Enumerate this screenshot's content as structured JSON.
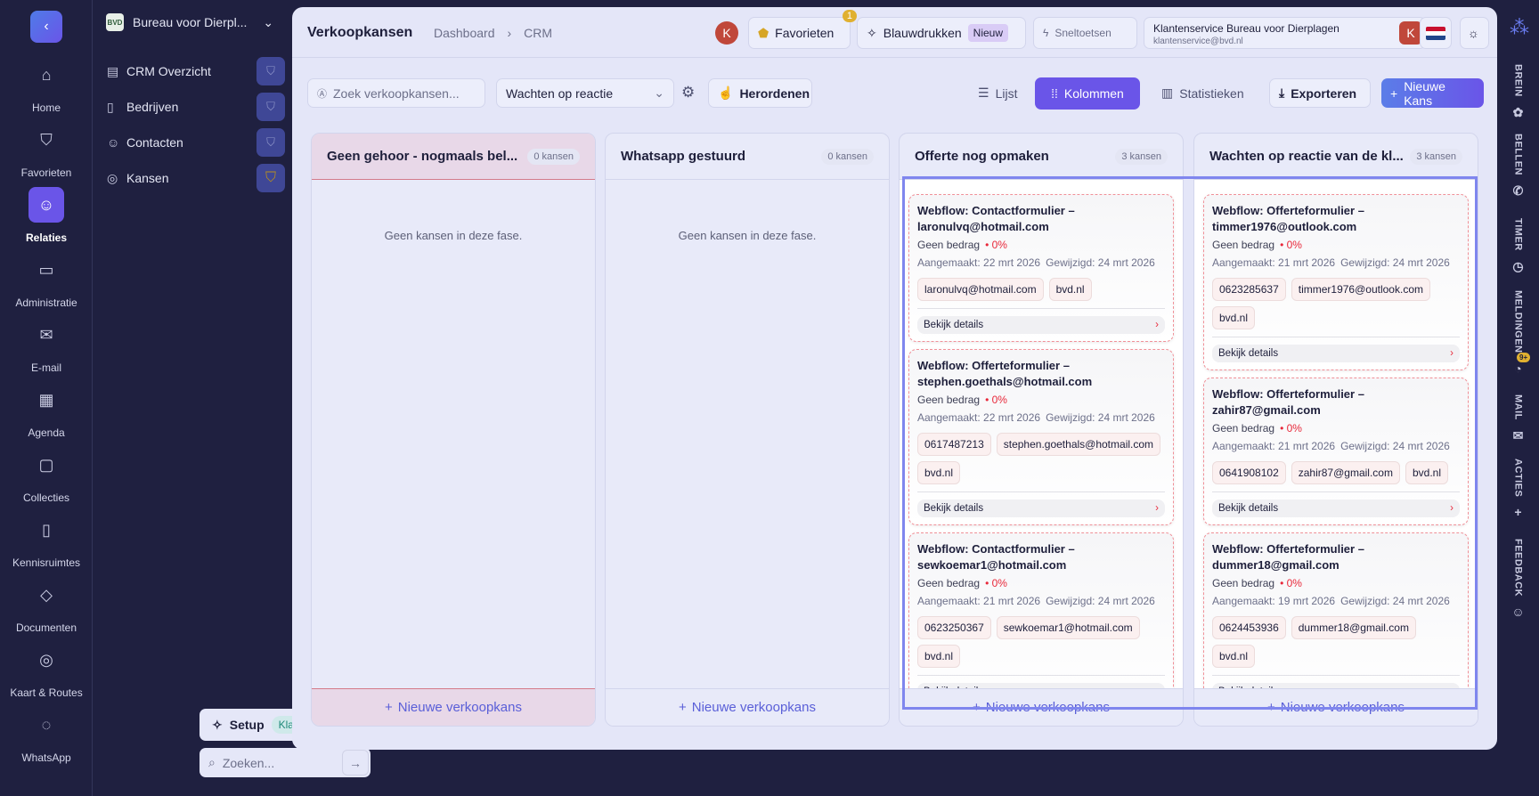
{
  "rail": {
    "items": [
      {
        "label": "Home",
        "icon": "home-icon"
      },
      {
        "label": "Favorieten",
        "icon": "shield-icon"
      },
      {
        "label": "Relaties",
        "icon": "contact-icon",
        "active": true
      },
      {
        "label": "Administratie",
        "icon": "wallet-icon"
      },
      {
        "label": "E-mail",
        "icon": "mail-icon"
      },
      {
        "label": "Agenda",
        "icon": "calendar-icon"
      },
      {
        "label": "Collecties",
        "icon": "box-icon"
      },
      {
        "label": "Kennisruimtes",
        "icon": "book-icon"
      },
      {
        "label": "Documenten",
        "icon": "document-icon"
      },
      {
        "label": "Kaart & Routes",
        "icon": "map-pin-icon"
      },
      {
        "label": "WhatsApp",
        "icon": "chat-icon"
      }
    ]
  },
  "sidebar": {
    "org": "Bureau voor Dierpl...",
    "logo": "BVD",
    "items": [
      {
        "label": "CRM Overzicht"
      },
      {
        "label": "Bedrijven"
      },
      {
        "label": "Contacten"
      },
      {
        "label": "Kansen",
        "favorite": true
      }
    ],
    "setup": "Setup",
    "setup_status": "Klaar",
    "search_placeholder": "Zoeken..."
  },
  "header": {
    "title": "Verkoopkansen",
    "breadcrumb": [
      "Dashboard",
      "CRM"
    ],
    "avatar": "K",
    "favorieten": "Favorieten",
    "fav_count": "1",
    "blauwdrukken": "Blauwdrukken",
    "nieuw": "Nieuw",
    "sneltoetsen": "Sneltoetsen",
    "account_name": "Klantenservice Bureau voor Dierplagen",
    "account_email": "klantenservice@bvd.nl",
    "account_avatar": "K"
  },
  "toolbar": {
    "search_placeholder": "Zoek verkoopkansen...",
    "filter": "Wachten op reactie",
    "reorder": "Herordenen",
    "views": [
      "Lijst",
      "Kolommen",
      "Statistieken"
    ],
    "active_view": "Kolommen",
    "export": "Exporteren",
    "new": "Nieuwe Kans"
  },
  "colors": {
    "accent": "#6a55e8",
    "danger": "#e8283a"
  },
  "columns": [
    {
      "name": "Geen gehoor - nogmaals bel...",
      "count": "0 kansen",
      "empty": "Geen kansen in deze fase.",
      "add": "Nieuwe verkoopkans",
      "cards": []
    },
    {
      "name": "Whatsapp gestuurd",
      "count": "0 kansen",
      "empty": "Geen kansen in deze fase.",
      "add": "Nieuwe verkoopkans",
      "cards": []
    },
    {
      "name": "Offerte nog opmaken",
      "count": "3 kansen",
      "add": "Nieuwe verkoopkans",
      "cards": [
        {
          "title": "Webflow: Contactformulier – laronulvq@hotmail.com",
          "amount": "Geen bedrag",
          "pct": "• 0%",
          "created": "Aangemaakt: 22 mrt 2026",
          "modified": "Gewijzigd: 24 mrt 2026",
          "tags": [
            "laronulvq@hotmail.com",
            "bvd.nl"
          ],
          "details": "Bekijk details"
        },
        {
          "title": "Webflow: Offerteformulier – stephen.goethals@hotmail.com",
          "amount": "Geen bedrag",
          "pct": "• 0%",
          "created": "Aangemaakt: 22 mrt 2026",
          "modified": "Gewijzigd: 24 mrt 2026",
          "tags": [
            "0617487213",
            "stephen.goethals@hotmail.com",
            "bvd.nl"
          ],
          "details": "Bekijk details"
        },
        {
          "title": "Webflow: Contactformulier – sewkoemar1@hotmail.com",
          "amount": "Geen bedrag",
          "pct": "• 0%",
          "created": "Aangemaakt: 21 mrt 2026",
          "modified": "Gewijzigd: 24 mrt 2026",
          "tags": [
            "0623250367",
            "sewkoemar1@hotmail.com",
            "bvd.nl"
          ],
          "details": "Bekijk details"
        }
      ]
    },
    {
      "name": "Wachten op reactie van de kl...",
      "count": "3 kansen",
      "add": "Nieuwe verkoopkans",
      "cards": [
        {
          "title": "Webflow: Offerteformulier – timmer1976@outlook.com",
          "amount": "Geen bedrag",
          "pct": "• 0%",
          "created": "Aangemaakt: 21 mrt 2026",
          "modified": "Gewijzigd: 24 mrt 2026",
          "tags": [
            "0623285637",
            "timmer1976@outlook.com",
            "bvd.nl"
          ],
          "details": "Bekijk details"
        },
        {
          "title": "Webflow: Offerteformulier – zahir87@gmail.com",
          "amount": "Geen bedrag",
          "pct": "• 0%",
          "created": "Aangemaakt: 21 mrt 2026",
          "modified": "Gewijzigd: 24 mrt 2026",
          "tags": [
            "0641908102",
            "zahir87@gmail.com",
            "bvd.nl"
          ],
          "details": "Bekijk details"
        },
        {
          "title": "Webflow: Offerteformulier – dummer18@gmail.com",
          "amount": "Geen bedrag",
          "pct": "• 0%",
          "created": "Aangemaakt: 19 mrt 2026",
          "modified": "Gewijzigd: 24 mrt 2026",
          "tags": [
            "0624453936",
            "dummer18@gmail.com",
            "bvd.nl"
          ],
          "details": "Bekijk details"
        }
      ]
    }
  ],
  "right_rail": {
    "items": [
      "BREIN",
      "BELLEN",
      "TIMER",
      "MELDINGEN",
      "MAIL",
      "ACTIES",
      "FEEDBACK"
    ],
    "notif_badge": "9+"
  }
}
